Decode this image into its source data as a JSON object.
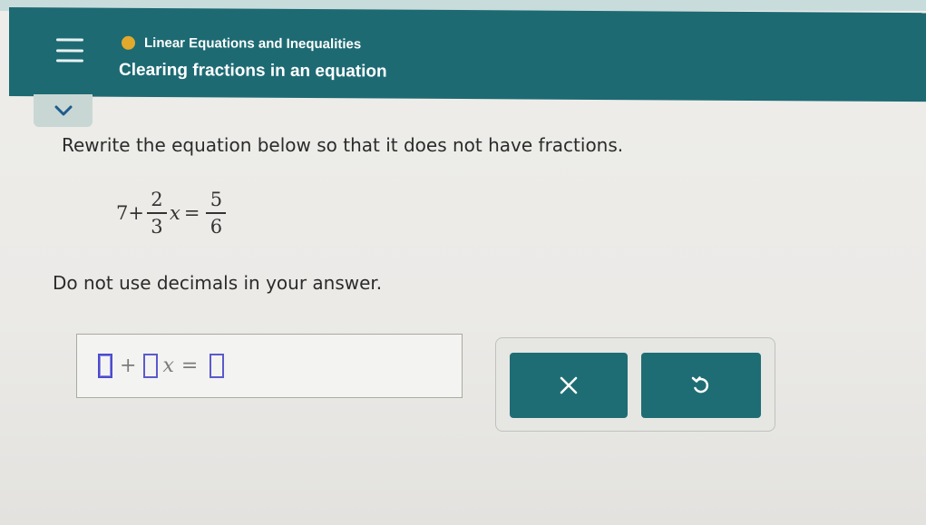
{
  "header": {
    "topic": "Linear Equations and Inequalities",
    "lesson_title": "Clearing fractions in an equation",
    "topic_dot_color": "#e2a92c",
    "background_color": "#1d6a73"
  },
  "problem": {
    "instruction": "Rewrite the equation below so that it does not have fractions.",
    "equation": {
      "constant": "7",
      "plus": "+",
      "coef_num": "2",
      "coef_den": "3",
      "variable": "x",
      "equals": "=",
      "rhs_num": "5",
      "rhs_den": "6"
    },
    "note": "Do not use decimals in your answer."
  },
  "answer": {
    "plus": "+",
    "variable": "x",
    "equals": "=",
    "slot_color": "#5a5acb"
  },
  "buttons": {
    "clear_icon": "close-icon",
    "undo_icon": "undo-icon",
    "color": "#1f6d74"
  }
}
